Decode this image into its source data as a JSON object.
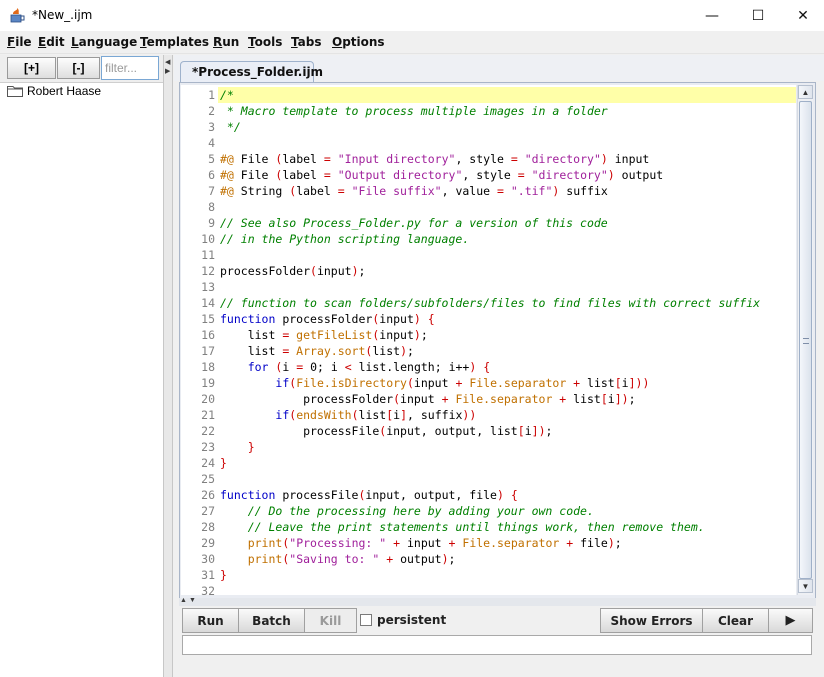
{
  "window": {
    "title": "*New_.ijm",
    "min": "—",
    "max": "☐",
    "close": "✕"
  },
  "menubar": [
    {
      "label": "File",
      "key": "F",
      "rest": "ile"
    },
    {
      "label": "Edit",
      "key": "E",
      "rest": "dit"
    },
    {
      "label": "Language",
      "key": "L",
      "rest": "anguage"
    },
    {
      "label": "Templates",
      "key": "T",
      "rest": "emplates"
    },
    {
      "label": "Run",
      "key": "R",
      "rest": "un"
    },
    {
      "label": "Tools",
      "key": "T",
      "rest": "ools"
    },
    {
      "label": "Tabs",
      "key": "T",
      "rest": "abs"
    },
    {
      "label": "Options",
      "key": "O",
      "rest": "ptions"
    }
  ],
  "sidebar": {
    "add_label": "[+]",
    "remove_label": "[-]",
    "filter_placeholder": "filter...",
    "tree": [
      {
        "label": "Robert Haase",
        "icon": "folder-icon"
      }
    ]
  },
  "editor": {
    "tab_label": "*Process_Folder.ijm",
    "line_numbers": [
      "1",
      "2",
      "3",
      "4",
      "5",
      "6",
      "7",
      "8",
      "9",
      "10",
      "11",
      "12",
      "13",
      "14",
      "15",
      "16",
      "17",
      "18",
      "19",
      "20",
      "21",
      "22",
      "23",
      "24",
      "25",
      "26",
      "27",
      "28",
      "29",
      "30",
      "31",
      "32"
    ],
    "lines": [
      "/*",
      " * Macro template to process multiple images in a folder",
      " */",
      "",
      "#@ File (label = \"Input directory\", style = \"directory\") input",
      "#@ File (label = \"Output directory\", style = \"directory\") output",
      "#@ String (label = \"File suffix\", value = \".tif\") suffix",
      "",
      "// See also Process_Folder.py for a version of this code",
      "// in the Python scripting language.",
      "",
      "processFolder(input);",
      "",
      "// function to scan folders/subfolders/files to find files with correct suffix",
      "function processFolder(input) {",
      "    list = getFileList(input);",
      "    list = Array.sort(list);",
      "    for (i = 0; i < list.length; i++) {",
      "        if(File.isDirectory(input + File.separator + list[i]))",
      "            processFolder(input + File.separator + list[i]);",
      "        if(endsWith(list[i], suffix))",
      "            processFile(input, output, list[i]);",
      "    }",
      "}",
      "",
      "function processFile(input, output, file) {",
      "    // Do the processing here by adding your own code.",
      "    // Leave the print statements until things work, then remove them.",
      "    print(\"Processing: \" + input + File.separator + file);",
      "    print(\"Saving to: \" + output);",
      "}",
      ""
    ]
  },
  "bottom_toolbar": {
    "run_label": "Run",
    "batch_label": "Batch",
    "kill_label": "Kill",
    "persistent_label": "persistent",
    "persistent_checked": false,
    "show_errors_label": "Show Errors",
    "clear_label": "Clear",
    "play_label": "▶"
  }
}
